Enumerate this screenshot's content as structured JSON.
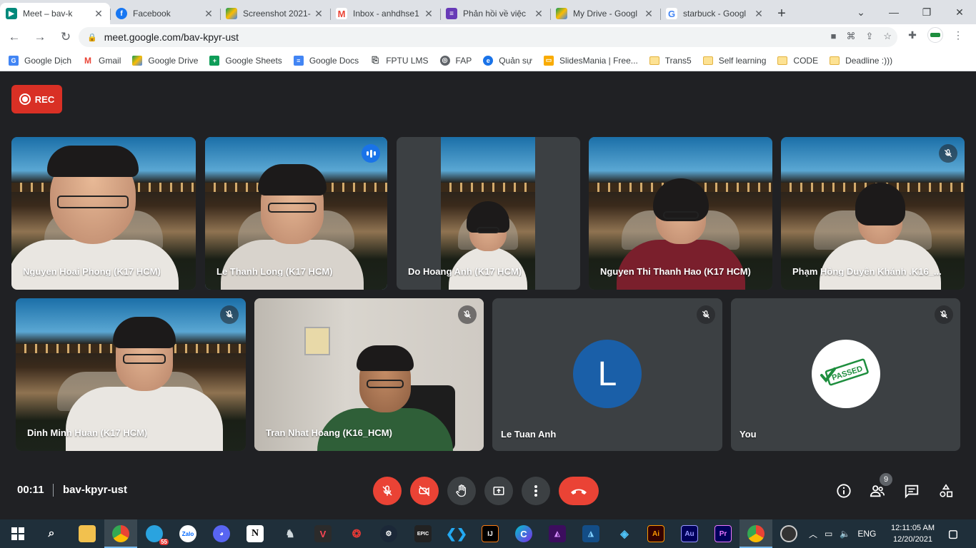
{
  "browser": {
    "tabs": [
      {
        "title": "Meet – bav-k",
        "icon": "meet-icon",
        "color": "#00897b",
        "active": true
      },
      {
        "title": "Facebook",
        "icon": "facebook-icon",
        "color": "#1877f2"
      },
      {
        "title": "Screenshot 2021-",
        "icon": "google-drive-icon",
        "color": "#fbbc04"
      },
      {
        "title": "Inbox - anhdhse1",
        "icon": "gmail-icon",
        "color": "#ea4335"
      },
      {
        "title": "Phản hồi về việc",
        "icon": "google-forms-icon",
        "color": "#673ab7"
      },
      {
        "title": "My Drive - Googl",
        "icon": "google-drive-icon",
        "color": "#fbbc04"
      },
      {
        "title": "starbuck - Googl",
        "icon": "google-icon",
        "color": "#4285f4"
      }
    ],
    "url": "meet.google.com/bav-kpyr-ust",
    "bookmarks": [
      {
        "label": "Google Dịch",
        "icon": "google-translate-icon",
        "color": "#4285f4"
      },
      {
        "label": "Gmail",
        "icon": "gmail-icon",
        "color": "#ea4335"
      },
      {
        "label": "Google Drive",
        "icon": "google-drive-icon",
        "color": "#fbbc04"
      },
      {
        "label": "Google Sheets",
        "icon": "google-sheets-icon",
        "color": "#0f9d58"
      },
      {
        "label": "Google Docs",
        "icon": "google-docs-icon",
        "color": "#4285f4"
      },
      {
        "label": "FPTU LMS",
        "icon": "lms-icon",
        "color": "#3c4043"
      },
      {
        "label": "FAP",
        "icon": "globe-icon",
        "color": "#5f6368"
      },
      {
        "label": "Quản sự",
        "icon": "edge-icon",
        "color": "#1a73e8"
      },
      {
        "label": "SlidesMania | Free...",
        "icon": "slidesmania-icon",
        "color": "#f9ab00"
      },
      {
        "label": "Trans5",
        "icon": "folder-icon",
        "folder": true
      },
      {
        "label": "Self learning",
        "icon": "folder-icon",
        "folder": true
      },
      {
        "label": "CODE",
        "icon": "folder-icon",
        "folder": true
      },
      {
        "label": "Deadline :)))",
        "icon": "folder-icon",
        "folder": true
      }
    ]
  },
  "meet": {
    "rec_label": "REC",
    "participants_row1": [
      {
        "name": "Nguyen Hoai Phong (K17 HCM)"
      },
      {
        "name": "Le Thanh Long (K17 HCM)",
        "speaking": true
      },
      {
        "name": "Do Hoang Anh (K17 HCM)"
      },
      {
        "name": "Nguyen Thi Thanh Hao (K17 HCM)"
      },
      {
        "name": "Phạm Hồng Duyên Khánh .K16_..."
      }
    ],
    "participants_row2": [
      {
        "name": "Dinh Minh Huan (K17 HCM)"
      },
      {
        "name": "Tran Nhat Hoang (K16_HCM)"
      },
      {
        "name": "Le Tuan Anh",
        "avatar_letter": "L"
      },
      {
        "name": "You",
        "avatar_stamp": "PASSED"
      }
    ],
    "elapsed_time": "00:11",
    "meeting_code": "bav-kpyr-ust",
    "participant_count": "9"
  },
  "taskbar": {
    "language": "ENG",
    "time": "12:11:05 AM",
    "date": "12/20/2021",
    "telegram_badge": "55",
    "app_labels": {
      "zalo": "Zalo",
      "epic": "EPIC",
      "ai": "Ai",
      "au": "Au",
      "pr": "Pr"
    }
  }
}
